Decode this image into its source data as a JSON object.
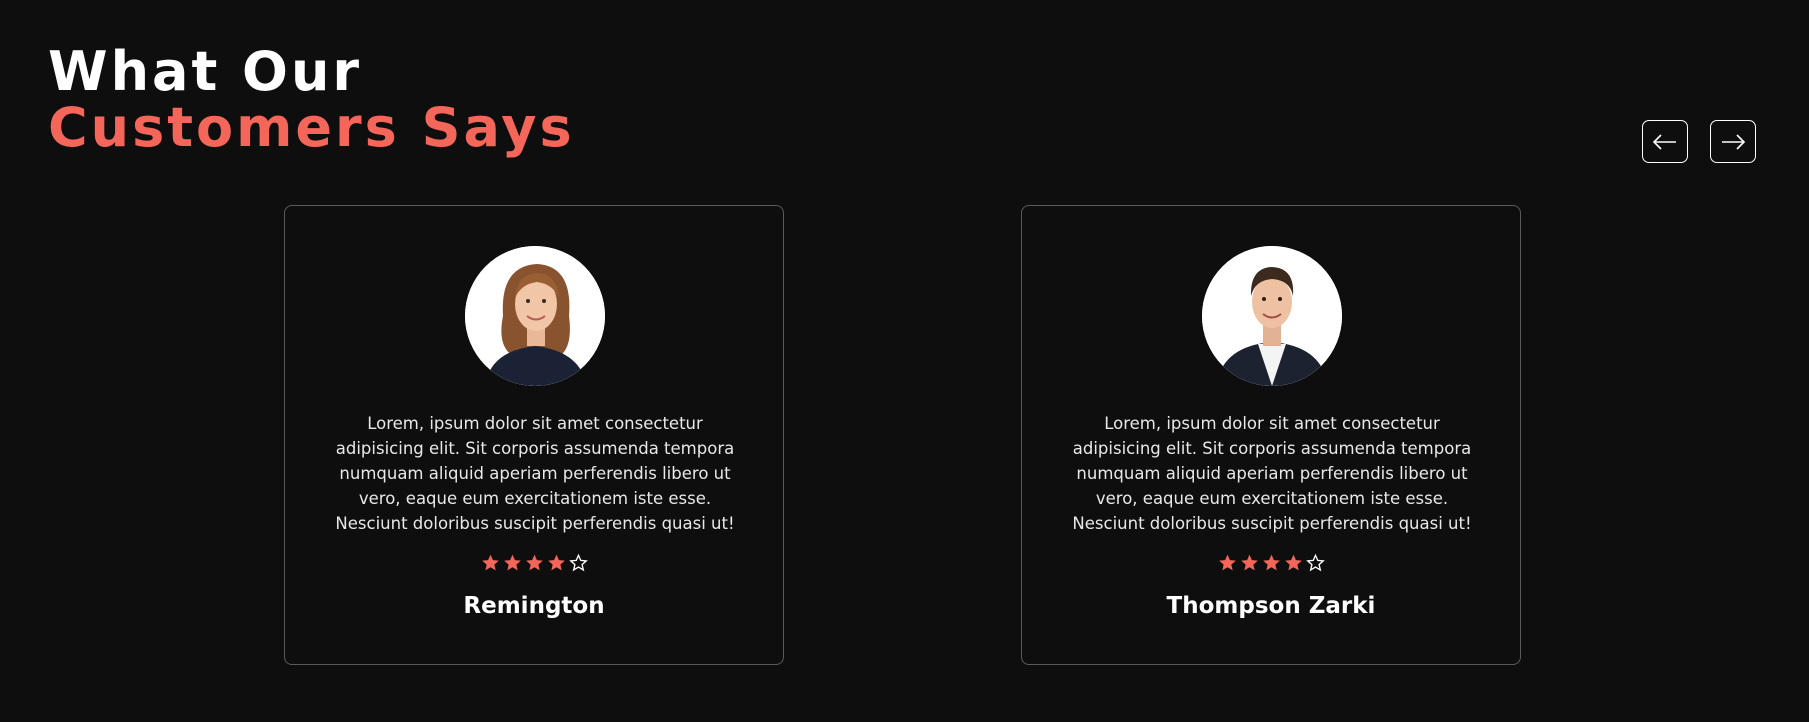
{
  "header": {
    "title_line1": "What Our",
    "title_line2": "Customers Says"
  },
  "carousel": {
    "prev_icon": "arrow-left-icon",
    "next_icon": "arrow-right-icon"
  },
  "colors": {
    "background": "#0e0e0e",
    "accent": "#f4665a",
    "text": "#ffffff",
    "card_border": "#5a5a5a"
  },
  "testimonials": [
    {
      "avatar": "woman-portrait",
      "text": "Lorem, ipsum dolor sit amet consectetur adipisicing elit. Sit corporis assumenda tempora numquam aliquid aperiam perferendis libero ut vero, eaque eum exercitationem iste esse. Nesciunt doloribus suscipit perferendis quasi ut!",
      "rating": 4,
      "rating_max": 5,
      "name": "Remington"
    },
    {
      "avatar": "man-portrait",
      "text": "Lorem, ipsum dolor sit amet consectetur adipisicing elit. Sit corporis assumenda tempora numquam aliquid aperiam perferendis libero ut vero, eaque eum exercitationem iste esse. Nesciunt doloribus suscipit perferendis quasi ut!",
      "rating": 4,
      "rating_max": 5,
      "name": "Thompson Zarki"
    }
  ]
}
